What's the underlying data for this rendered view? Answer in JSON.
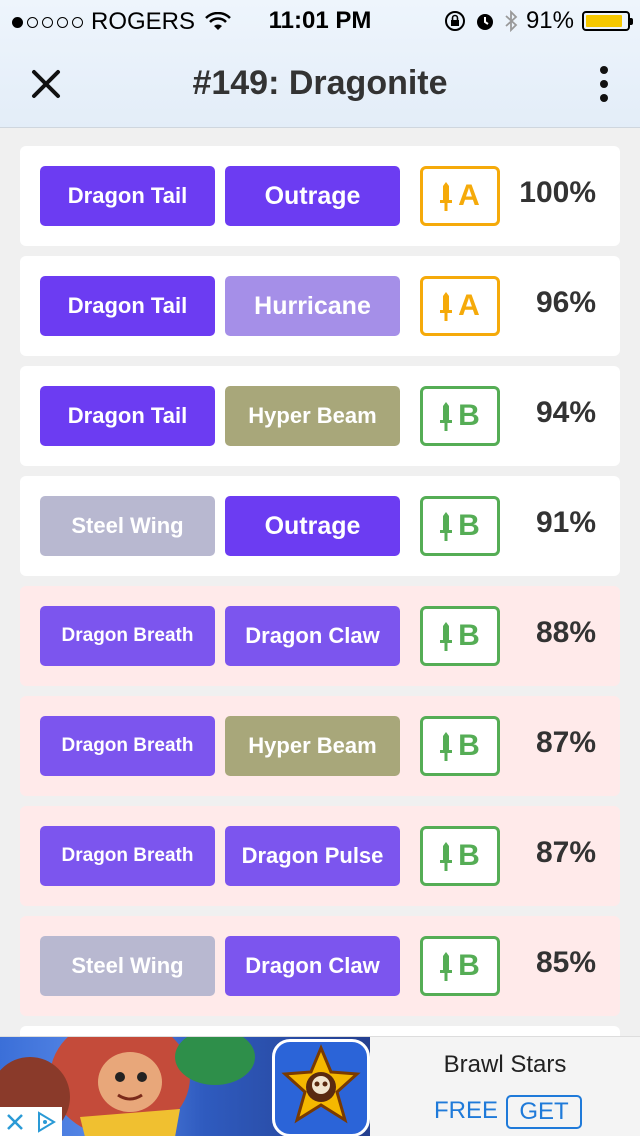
{
  "status_bar": {
    "carrier": "ROGERS",
    "time": "11:01 PM",
    "battery_text": "91%",
    "battery_level": 0.91,
    "battery_color": "#f6c800"
  },
  "nav": {
    "title": "#149: Dragonite",
    "close_icon": "close-icon",
    "more_icon": "more-vertical-icon"
  },
  "colors": {
    "dragon": "#6c3cf2",
    "dragon_light": "#7c55ee",
    "flying": "#a58fe8",
    "normal": "#a8a77a",
    "steel": "#b8b8d0",
    "grade_a": "#f5aa0a",
    "grade_b": "#55ad55",
    "weak_row_bg": "#ffeaea"
  },
  "movesets": [
    {
      "fast": "Dragon Tail",
      "charge": "Outrage",
      "grade": "A",
      "percent": "100%"
    },
    {
      "fast": "Dragon Tail",
      "charge": "Hurricane",
      "grade": "A",
      "percent": "96%"
    },
    {
      "fast": "Dragon Tail",
      "charge": "Hyper Beam",
      "grade": "B",
      "percent": "94%"
    },
    {
      "fast": "Steel Wing",
      "charge": "Outrage",
      "grade": "B",
      "percent": "91%"
    },
    {
      "fast": "Dragon Breath",
      "charge": "Dragon Claw",
      "grade": "B",
      "percent": "88%"
    },
    {
      "fast": "Dragon Breath",
      "charge": "Hyper Beam",
      "grade": "B",
      "percent": "87%"
    },
    {
      "fast": "Dragon Breath",
      "charge": "Dragon Pulse",
      "grade": "B",
      "percent": "87%"
    },
    {
      "fast": "Steel Wing",
      "charge": "Dragon Claw",
      "grade": "B",
      "percent": "85%"
    }
  ],
  "ad": {
    "title": "Brawl Stars",
    "price": "FREE",
    "cta": "GET"
  }
}
